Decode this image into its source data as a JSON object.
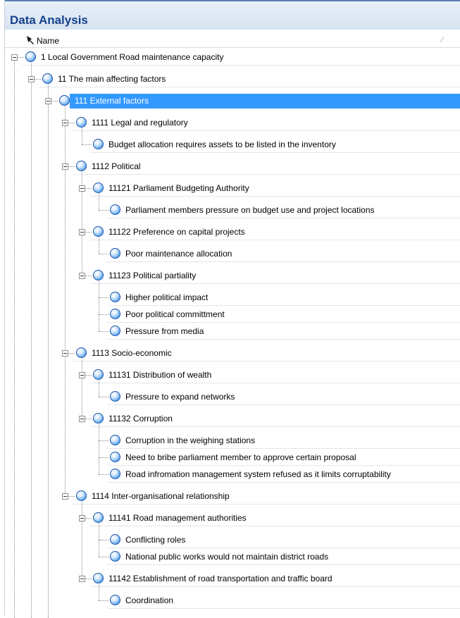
{
  "panel": {
    "title": "Data Analysis"
  },
  "columns": {
    "name": "Name",
    "sort_indicator": "⁄"
  },
  "tree": [
    {
      "label": "1 Local Government Road maintenance capacity",
      "depth": 0,
      "expanded": true
    },
    {
      "label": "11 The main affecting factors",
      "depth": 1,
      "expanded": true
    },
    {
      "label": "111 External factors",
      "depth": 2,
      "expanded": true,
      "selected": true
    },
    {
      "label": "1111 Legal and regulatory",
      "depth": 3,
      "expanded": true
    },
    {
      "label": "Budget allocation requires assets to be listed in the inventory",
      "depth": 4
    },
    {
      "label": "1112 Political",
      "depth": 3,
      "expanded": true
    },
    {
      "label": "11121 Parliament Budgeting Authority",
      "depth": 4,
      "expanded": true
    },
    {
      "label": "Parliament members pressure on budget use and project locations",
      "depth": 5
    },
    {
      "label": "11122 Preference on capital projects",
      "depth": 4,
      "expanded": true
    },
    {
      "label": "Poor maintenance allocation",
      "depth": 5
    },
    {
      "label": "11123 Political partiality",
      "depth": 4,
      "expanded": true
    },
    {
      "label": "Higher political impact",
      "depth": 5
    },
    {
      "label": "Poor political committment",
      "depth": 5
    },
    {
      "label": "Pressure from media",
      "depth": 5
    },
    {
      "label": "1113 Socio-economic",
      "depth": 3,
      "expanded": true
    },
    {
      "label": "11131 Distribution of wealth",
      "depth": 4,
      "expanded": true
    },
    {
      "label": "Pressure to expand networks",
      "depth": 5
    },
    {
      "label": "11132 Corruption",
      "depth": 4,
      "expanded": true
    },
    {
      "label": "Corruption in the weighing stations",
      "depth": 5
    },
    {
      "label": "Need to bribe parliament member to approve certain proposal",
      "depth": 5
    },
    {
      "label": "Road infromation management system refused as it limits corruptability",
      "depth": 5
    },
    {
      "label": "1114 Inter-organisational relationship",
      "depth": 3,
      "expanded": true
    },
    {
      "label": "11141 Road management authorities",
      "depth": 4,
      "expanded": true
    },
    {
      "label": "Conflicting roles",
      "depth": 5
    },
    {
      "label": "National public works would not maintain district roads",
      "depth": 5
    },
    {
      "label": "11142 Establishment of road transportation and traffic board",
      "depth": 4,
      "expanded": true
    },
    {
      "label": "Coordination",
      "depth": 5
    }
  ],
  "colors": {
    "selection": "#3399ff",
    "title_text": "#15428b",
    "node_blue": "#2a6fd0"
  }
}
